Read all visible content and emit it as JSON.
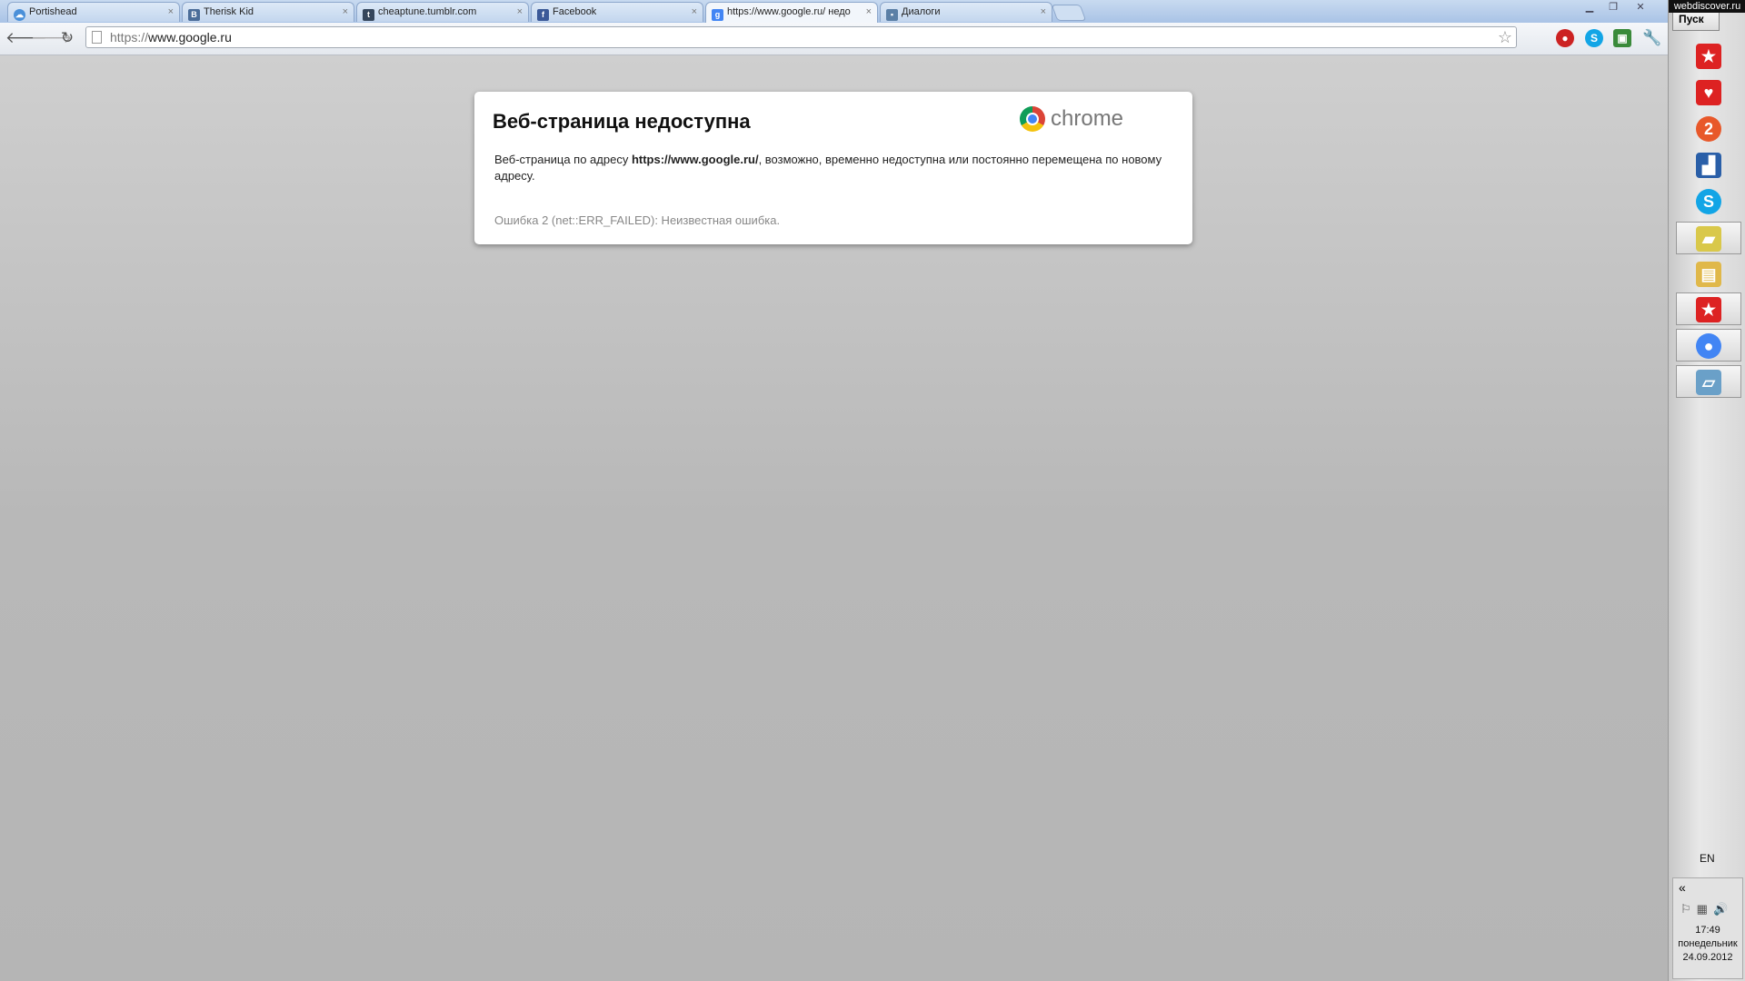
{
  "tabs": [
    {
      "title": "Portishead",
      "favicon": "cloud-icon",
      "color": "#4a90d9"
    },
    {
      "title": "Therisk Kid",
      "favicon": "vk-icon",
      "color": "#4b6d99"
    },
    {
      "title": "cheaptune.tumblr.com",
      "favicon": "tumblr-icon",
      "color": "#35465c"
    },
    {
      "title": "Facebook",
      "favicon": "facebook-icon",
      "color": "#3b5998"
    },
    {
      "title": "https://www.google.ru/ недо",
      "favicon": "google-icon",
      "color": "#4285f4",
      "active": true
    },
    {
      "title": "Диалоги",
      "favicon": "chat-icon",
      "color": "#5a7fa6"
    }
  ],
  "toolbar": {
    "url_scheme": "https://",
    "url_host": "www.google.ru"
  },
  "error": {
    "title": "Веб-страница недоступна",
    "brand": "chrome",
    "desc_before": "Веб-страница по адресу ",
    "desc_url": "https://www.google.ru/",
    "desc_after": ", возможно, временно недоступна или постоянно перемещена по новому адресу.",
    "code": "Ошибка 2 (net::ERR_FAILED): Неизвестная ошибка."
  },
  "taskbar": {
    "watermark": "webdiscover.ru",
    "start_label": "Пуск",
    "language": "EN",
    "tray_chevron": "«",
    "clock_time": "17:49",
    "clock_day": "понедельник",
    "clock_date": "24.09.2012",
    "icons": [
      {
        "name": "pokerstars-icon",
        "glyph": "★",
        "color": "#d22"
      },
      {
        "name": "heart-app-icon",
        "glyph": "♥",
        "color": "#d22"
      },
      {
        "name": "badge-2-icon",
        "glyph": "2",
        "color": "#e8582a"
      },
      {
        "name": "chart-app-icon",
        "glyph": "▟",
        "color": "#2a5fa8"
      },
      {
        "name": "skype-icon",
        "glyph": "S",
        "color": "#12a5e6"
      },
      {
        "name": "sticky-notes-icon",
        "glyph": "▰",
        "color": "#d9c84a"
      },
      {
        "name": "folder-icon",
        "glyph": "▤",
        "color": "#e0b84a"
      },
      {
        "name": "pokerstars-icon",
        "glyph": "★",
        "color": "#d22"
      },
      {
        "name": "chrome-icon",
        "glyph": "●",
        "color": "#4285f4"
      },
      {
        "name": "notepad-icon",
        "glyph": "▱",
        "color": "#6aa0c8"
      }
    ]
  }
}
